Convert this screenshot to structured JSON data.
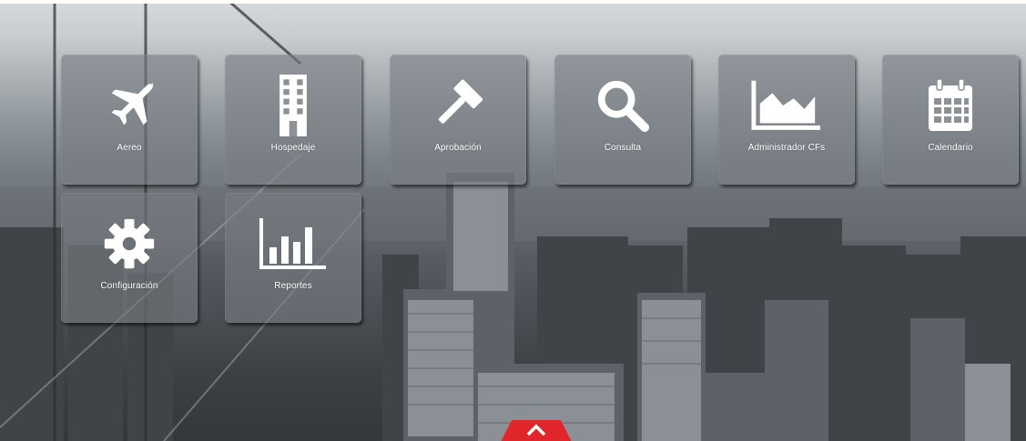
{
  "menu": {
    "tiles": [
      {
        "label": "Aereo",
        "icon": "airplane-icon"
      },
      {
        "label": "Hospedaje",
        "icon": "building-icon"
      },
      {
        "label": "Aprobación",
        "icon": "gavel-icon"
      },
      {
        "label": "Consulta",
        "icon": "search-icon"
      },
      {
        "label": "Administrador CFs",
        "icon": "area-chart-icon"
      },
      {
        "label": "Calendario",
        "icon": "calendar-icon"
      },
      {
        "label": "Configuración",
        "icon": "gear-icon"
      },
      {
        "label": "Reportes",
        "icon": "bar-chart-icon"
      }
    ]
  },
  "footer": {
    "scroll_up_icon": "chevron-up-icon"
  },
  "colors": {
    "tile_background": "#787d82",
    "label_text": "#ffffff",
    "accent_red": "#e0262a"
  }
}
